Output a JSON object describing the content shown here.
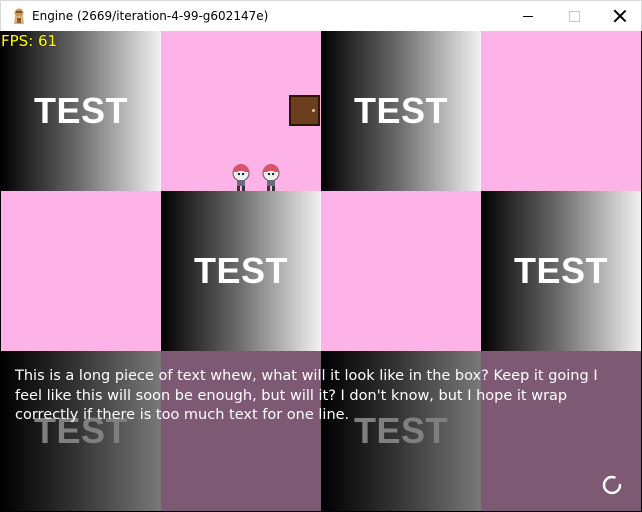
{
  "window": {
    "title": "Engine (2669/iteration-4-99-g602147e)"
  },
  "hud": {
    "fps_label": "FPS: 61"
  },
  "tiles": [
    [
      "TEST",
      "",
      "TEST",
      ""
    ],
    [
      "",
      "TEST",
      "",
      "TEST"
    ],
    [
      "TEST",
      "",
      "TEST",
      ""
    ]
  ],
  "dialog": {
    "text": "This is a long piece of text whew, what will it look like in the box? Keep it going I feel like this will soon be enough, but will it? I don't know, but I hope it wrap correctly if there is too much text for one line."
  },
  "colors": {
    "tile_pink": "#fdb2e8",
    "fps_text": "#ffff00",
    "dialog_overlay": "rgba(0,0,0,0.5)"
  },
  "icons": {
    "app": "engine-app-icon",
    "door": "door-icon",
    "npc": "character-sprite-icon",
    "loading": "loading-spinner-icon"
  }
}
